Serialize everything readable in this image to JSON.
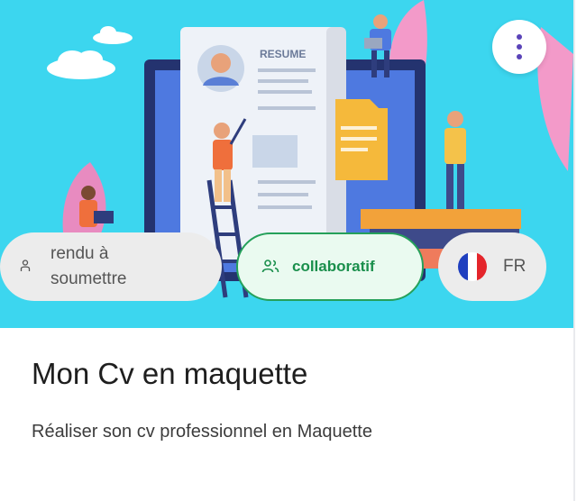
{
  "card": {
    "illustration": {
      "resume_heading": "RESUME"
    },
    "menu_icon": "kebab-vertical-icon",
    "chips": {
      "status": {
        "icon": "person-icon",
        "label": "rendu à soumettre"
      },
      "collaboration": {
        "icon": "people-icon",
        "label": "collaboratif"
      },
      "language": {
        "icon": "france-flag-icon",
        "label": "FR"
      }
    },
    "title": "Mon Cv en maquette",
    "description": "Réaliser son cv professionnel en Maquette"
  },
  "colors": {
    "hero_background": "#3cd6ef",
    "collab_border": "#25a05a",
    "collab_text": "#1a8f4c",
    "chip_background": "#ececec",
    "menu_dots": "#5a43b8"
  }
}
